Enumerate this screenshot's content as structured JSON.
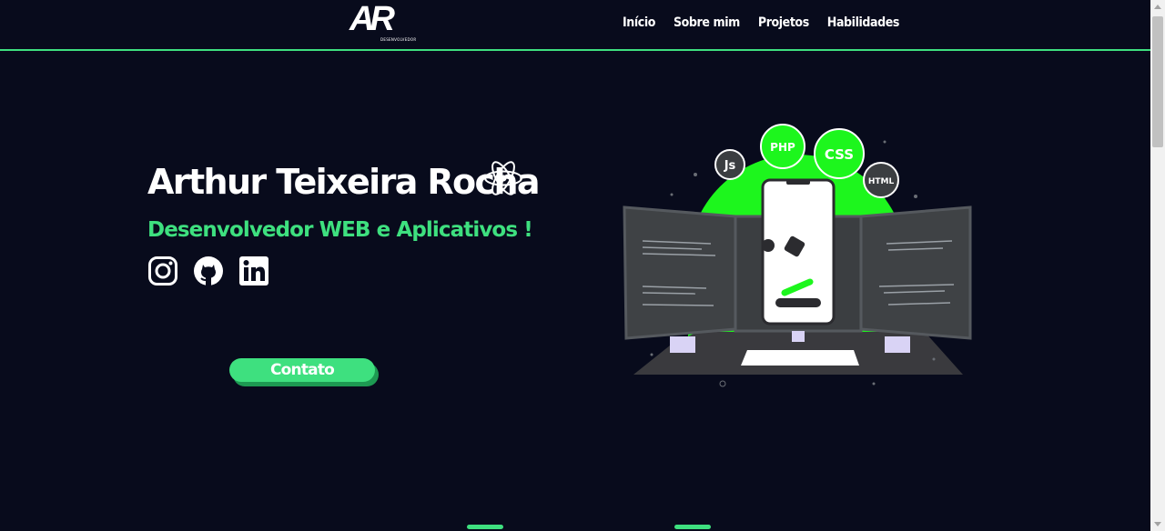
{
  "header": {
    "logo": {
      "mark": "AR",
      "subtitle": "DESENVOLVEDOR"
    },
    "nav": [
      "Início",
      "Sobre mim",
      "Projetos",
      "Habilidades"
    ]
  },
  "hero": {
    "name": "Arthur Teixeira Rocha",
    "role": "Desenvolvedor WEB e Aplicativos !",
    "socials": [
      "instagram-icon",
      "github-icon",
      "linkedin-icon"
    ],
    "contact_label": "Contato"
  },
  "illustration": {
    "badges": [
      "Js",
      "PHP",
      "CSS",
      "HTML"
    ]
  },
  "colors": {
    "accent": "#3ee07f",
    "background": "#080b1c",
    "bright_green": "#1df61d"
  }
}
